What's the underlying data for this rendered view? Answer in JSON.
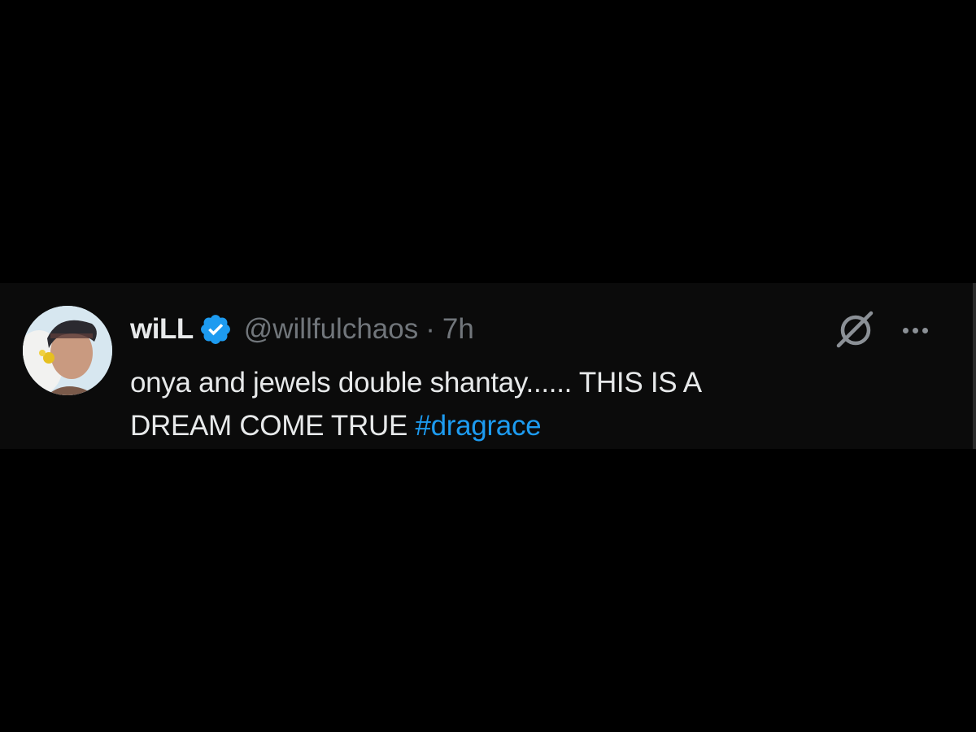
{
  "tweet": {
    "display_name": "wiLL",
    "handle": "@willfulchaos",
    "separator": "·",
    "time": "7h",
    "text_line1": "onya and jewels double shantay...... THIS IS A",
    "text_line2": "DREAM COME TRUE",
    "hashtag": "#dragrace",
    "verified": true,
    "icons": {
      "verified": "verified-badge-icon",
      "grok": "grok-icon",
      "more": "more-options-icon"
    }
  },
  "colors": {
    "background": "#000000",
    "card": "#0b0b0b",
    "text_primary": "#e7e9ea",
    "text_secondary": "#71767b",
    "accent": "#1d9bf0"
  }
}
